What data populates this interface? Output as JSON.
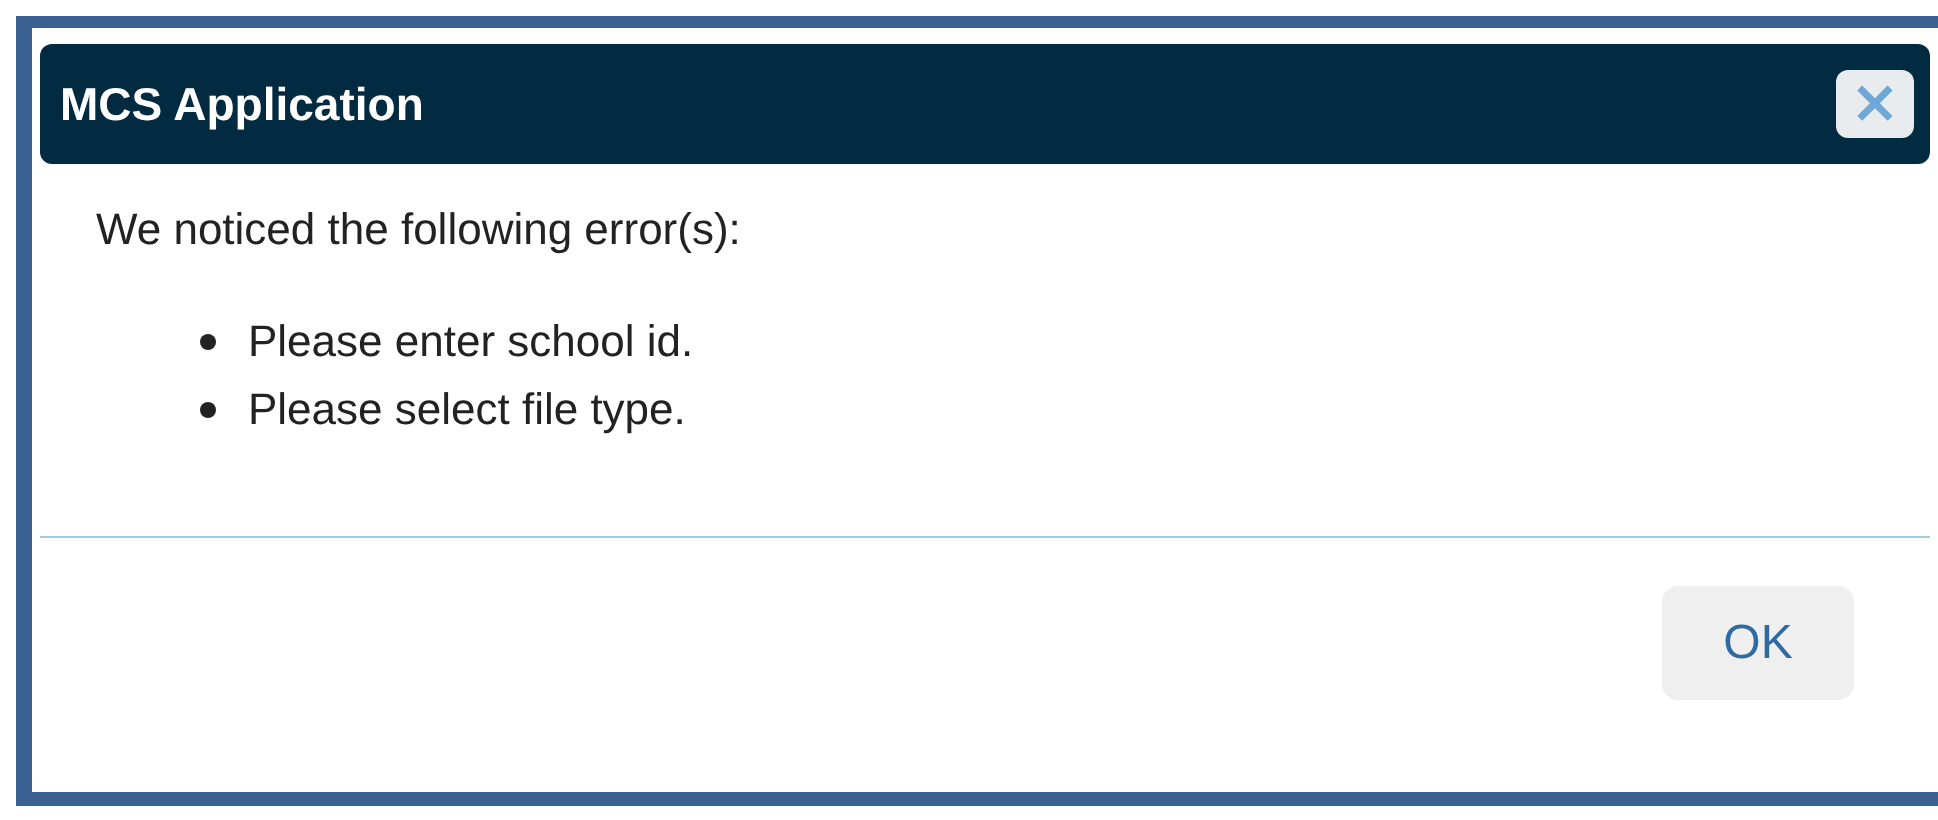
{
  "dialog": {
    "title": "MCS Application",
    "close": "×",
    "message": "We noticed the following error(s):",
    "errors": [
      "Please enter school id.",
      "Please select file type."
    ],
    "buttons": [
      "OK"
    ]
  }
}
